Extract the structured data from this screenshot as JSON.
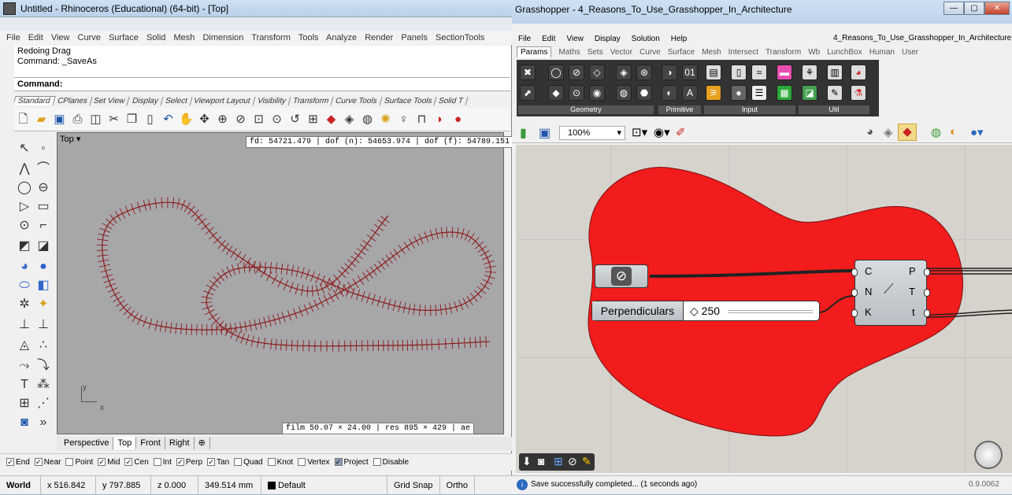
{
  "rhino": {
    "title": "Untitled - Rhinoceros (Educational) (64-bit) - [Top]",
    "menu": [
      "File",
      "Edit",
      "View",
      "Curve",
      "Surface",
      "Solid",
      "Mesh",
      "Dimension",
      "Transform",
      "Tools",
      "Analyze",
      "Render",
      "Panels",
      "SectionTools"
    ],
    "history_line1": "Redoing Drag",
    "history_line2": "Command: _SaveAs",
    "command_label": "Command:",
    "tabs": [
      "Standard",
      "CPlanes",
      "Set View",
      "Display",
      "Select",
      "Viewport Layout",
      "Visibility",
      "Transform",
      "Curve Tools",
      "Surface Tools",
      "Solid T"
    ],
    "viewport": {
      "label": "Top",
      "info": "fd: 54721.479 | dof (n): 54653.974 | dof (f): 54789.151",
      "film": "film 50.07 × 24.00 | res 895 × 429 | ae",
      "axis_y": "y",
      "axis_x": "x"
    },
    "view_tabs": [
      "Perspective",
      "Top",
      "Front",
      "Right"
    ],
    "osnaps": [
      {
        "label": "End",
        "checked": true
      },
      {
        "label": "Near",
        "checked": true
      },
      {
        "label": "Point",
        "checked": false
      },
      {
        "label": "Mid",
        "checked": true
      },
      {
        "label": "Cen",
        "checked": true
      },
      {
        "label": "Int",
        "checked": false
      },
      {
        "label": "Perp",
        "checked": true
      },
      {
        "label": "Tan",
        "checked": true
      },
      {
        "label": "Quad",
        "checked": false
      },
      {
        "label": "Knot",
        "checked": false
      },
      {
        "label": "Vertex",
        "checked": false
      },
      {
        "label": "Project",
        "checked": true
      },
      {
        "label": "Disable",
        "checked": false
      }
    ],
    "status": {
      "cplane": "World",
      "x": "x 516.842",
      "y": "y 797.885",
      "z": "z 0.000",
      "unit": "349.514 mm",
      "layer": "Default",
      "grid": "Grid Snap",
      "ortho": "Ortho"
    },
    "curve_color": "#8b1a1a"
  },
  "gh": {
    "title": "Grasshopper - 4_Reasons_To_Use_Grasshopper_In_Architecture",
    "menu": [
      "File",
      "Edit",
      "View",
      "Display",
      "Solution",
      "Help"
    ],
    "filename": "4_Reasons_To_Use_Grasshopper_In_Architecture",
    "tabs": [
      "Params",
      "Maths",
      "Sets",
      "Vector",
      "Curve",
      "Surface",
      "Mesh",
      "Intersect",
      "Transform",
      "Wb",
      "LunchBox",
      "Human",
      "User"
    ],
    "groups": [
      "Geometry",
      "Primitive",
      "Input",
      "Util"
    ],
    "zoom": "100%",
    "slider_label": "Perpendiculars",
    "slider_value": "◇ 250",
    "comp_inputs": [
      "C",
      "N",
      "K"
    ],
    "comp_outputs": [
      "P",
      "T",
      "t"
    ],
    "status_msg": "Save successfully completed... (1 seconds ago)",
    "version": "0.9.0062",
    "group_color": "#f21c1c"
  }
}
